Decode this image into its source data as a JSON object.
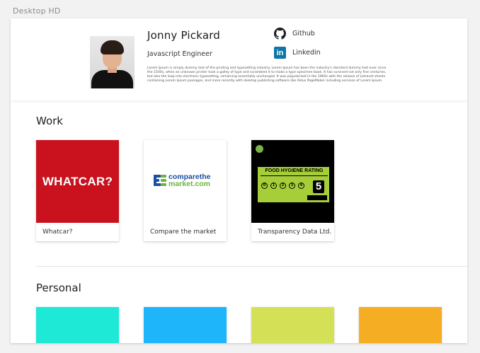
{
  "artboard": {
    "label": "Desktop HD"
  },
  "profile": {
    "name": "Jonny Pickard",
    "role": "Javascript Engineer",
    "bio": "Lorem Ipsum is simply dummy text of the printing and typesetting industry. Lorem Ipsum has been the industry's standard dummy text ever since the 1500s, when an unknown printer took a galley of type and scrambled it to make a type specimen book. It has survived not only five centuries, but also the leap into electronic typesetting, remaining essentially unchanged. It was popularised in the 1960s with the release of Letraset sheets containing Lorem Ipsum passages, and more recently with desktop publishing software like Aldus PageMaker including versions of Lorem Ipsum.",
    "links": [
      {
        "label": "Github",
        "icon": "github-icon"
      },
      {
        "label": "Linkedin",
        "icon": "linkedin-icon",
        "icon_text": "in"
      }
    ]
  },
  "work": {
    "title": "Work",
    "items": [
      {
        "caption": "Whatcar?",
        "thumb_text": "WHATCAR?",
        "thumb_color": "#c9121e"
      },
      {
        "caption": "Compare the market",
        "logo_top": "comparethe",
        "logo_bottom": "market.com"
      },
      {
        "caption": "Transparency Data Ltd.",
        "badge_title": "FOOD HYGIENE RATING",
        "rating": "5",
        "scale": [
          "0",
          "1",
          "2",
          "3",
          "4"
        ]
      }
    ]
  },
  "personal": {
    "title": "Personal",
    "swatches": [
      "#1de9d6",
      "#1eb5fb",
      "#d4e157",
      "#f5ad23"
    ]
  }
}
